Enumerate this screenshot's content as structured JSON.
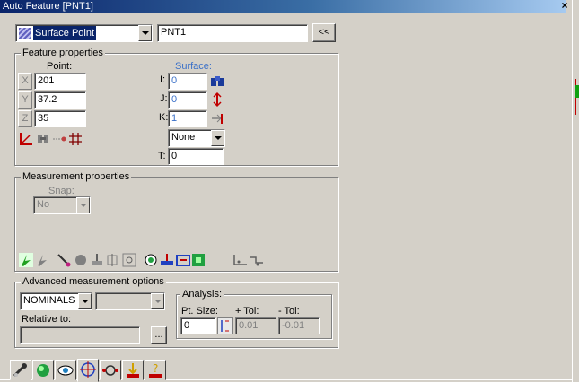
{
  "window": {
    "title": "Auto Feature [PNT1]",
    "close_glyph": "×"
  },
  "header": {
    "feature_type": "Surface Point",
    "feature_name": "PNT1",
    "collapse_label": "<<"
  },
  "feature_properties": {
    "legend": "Feature properties",
    "point_label": "Point:",
    "surface_label": "Surface:",
    "x_label": "X",
    "y_label": "Y",
    "z_label": "Z",
    "x": "201",
    "y": "37.2",
    "z": "35",
    "i_label": "I:",
    "j_label": "J:",
    "k_label": "K:",
    "i": "0",
    "j": "0",
    "k": "1",
    "none_option": "None",
    "t_label": "T:",
    "t": "0"
  },
  "measurement_properties": {
    "legend": "Measurement properties",
    "snap_label": "Snap:",
    "snap_value": "No"
  },
  "advanced": {
    "legend": "Advanced measurement options",
    "nominals": "NOMINALS",
    "second_select": "",
    "relative_to_label": "Relative to:",
    "relative_to_value": "",
    "browse_label": "...",
    "analysis_legend": "Analysis:",
    "pt_size_label": "Pt. Size:",
    "plus_tol_label": "+ Tol:",
    "minus_tol_label": "- Tol:",
    "pt_size": "0",
    "plus_tol": "0.01",
    "minus_tol": "-0.01"
  },
  "tabs": [
    "probe-tab",
    "contact-tab",
    "vision-tab",
    "target-tab",
    "path-tab",
    "settings-tab",
    "hint-tab"
  ],
  "colors": {
    "title_start": "#0a246a",
    "title_end": "#a6caf0",
    "face": "#d4d0c8",
    "surface_blue": "#3a70c8"
  }
}
